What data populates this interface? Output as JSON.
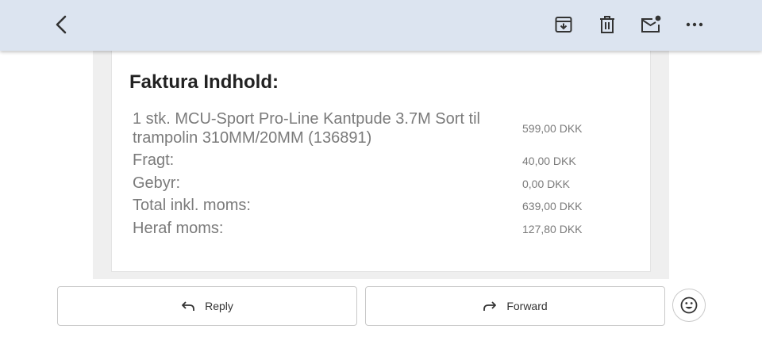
{
  "toolbar": {
    "icons": [
      "back-arrow-icon",
      "archive-icon",
      "trash-icon",
      "mark-unread-icon",
      "more-options-icon"
    ]
  },
  "invoice": {
    "heading": "Faktura Indhold:",
    "items": [
      {
        "label": "1 stk. MCU-Sport Pro-Line Kantpude 3.7M Sort til trampolin 310MM/20MM (136891)",
        "amount": "599,00 DKK"
      },
      {
        "label": "Fragt:",
        "amount": "40,00 DKK"
      },
      {
        "label": "Gebyr:",
        "amount": "0,00 DKK"
      },
      {
        "label": "Total inkl. moms:",
        "amount": "639,00 DKK"
      },
      {
        "label": "Heraf moms:",
        "amount": "127,80 DKK"
      }
    ]
  },
  "actions": {
    "reply_label": "Reply",
    "forward_label": "Forward"
  },
  "colors": {
    "toolbar_bg": "#dce4f0",
    "icon_color": "#333333",
    "text_muted": "#7b7b7b"
  }
}
